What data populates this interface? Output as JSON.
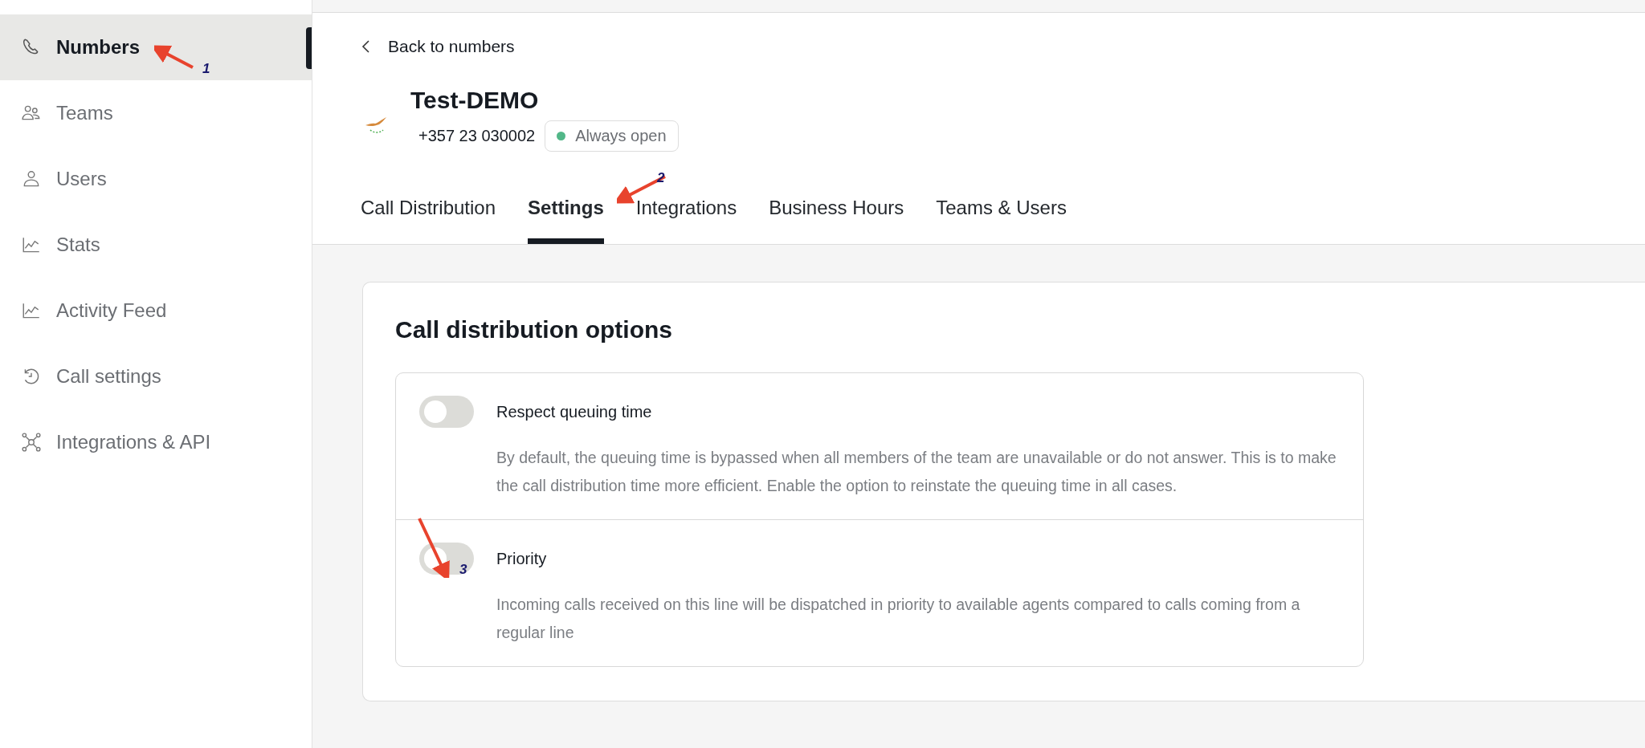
{
  "sidebar": {
    "items": [
      {
        "label": "Numbers",
        "selected": true
      },
      {
        "label": "Teams",
        "selected": false
      },
      {
        "label": "Users",
        "selected": false
      },
      {
        "label": "Stats",
        "selected": false
      },
      {
        "label": "Activity Feed",
        "selected": false
      },
      {
        "label": "Call settings",
        "selected": false
      },
      {
        "label": "Integrations & API",
        "selected": false
      }
    ]
  },
  "header": {
    "back_link": "Back to numbers",
    "title": "Test-DEMO",
    "phone": "+357 23 030002",
    "status_badge": "Always open",
    "tabs": [
      {
        "label": "Call Distribution",
        "selected": false
      },
      {
        "label": "Settings",
        "selected": true
      },
      {
        "label": "Integrations",
        "selected": false
      },
      {
        "label": "Business Hours",
        "selected": false
      },
      {
        "label": "Teams & Users",
        "selected": false
      }
    ]
  },
  "card": {
    "heading": "Call distribution options",
    "options": [
      {
        "title": "Respect queuing time",
        "on": false,
        "description": "By default, the queuing time is bypassed when all members of the team are unavailable or do not answer. This is to make the call distribution time more efficient. Enable the option to reinstate the queuing time in all cases."
      },
      {
        "title": "Priority",
        "on": false,
        "description": "Incoming calls received on this line will be dispatched in priority to available agents compared to calls coming from a regular line"
      }
    ]
  },
  "annotations": [
    {
      "label": "1"
    },
    {
      "label": "2"
    },
    {
      "label": "3"
    }
  ]
}
